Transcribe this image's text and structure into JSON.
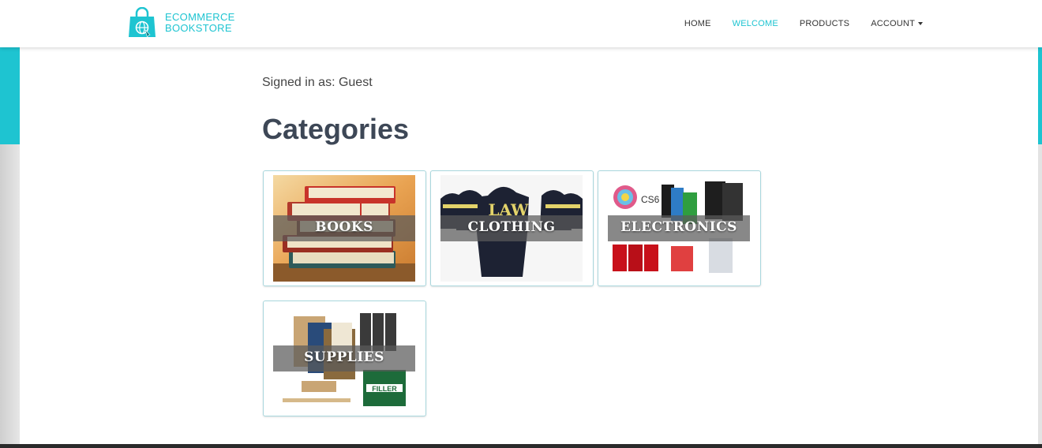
{
  "brand": {
    "line1": "ECOMMERCE",
    "line2": "BOOKSTORE",
    "icon": "shopping-bag-globe-icon",
    "color": "#1ec4d1"
  },
  "nav": {
    "items": [
      {
        "label": "HOME",
        "active": false
      },
      {
        "label": "WELCOME",
        "active": true
      },
      {
        "label": "PRODUCTS",
        "active": false
      },
      {
        "label": "ACCOUNT",
        "active": false,
        "dropdown": true
      }
    ]
  },
  "main": {
    "signed_in": "Signed in as: Guest",
    "heading": "Categories",
    "categories": [
      {
        "label": "BOOKS"
      },
      {
        "label": "CLOTHING",
        "image_text": "LAW"
      },
      {
        "label": "ELECTRONICS",
        "image_text": "CS6"
      },
      {
        "label": "SUPPLIES",
        "image_text": "FILLER"
      }
    ]
  },
  "colors": {
    "accent": "#1ec4d1",
    "heading": "#3d4756",
    "card_border": "#a9d7dd"
  }
}
